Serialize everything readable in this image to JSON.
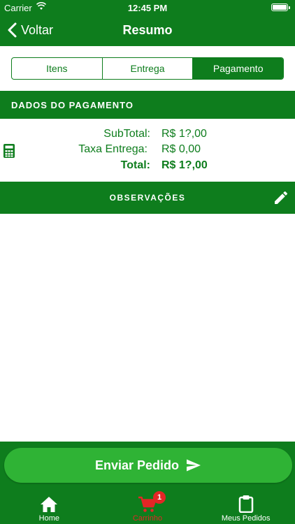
{
  "status_bar": {
    "carrier": "Carrier",
    "time": "12:45 PM"
  },
  "nav": {
    "back_label": "Voltar",
    "title": "Resumo"
  },
  "tabs_segment": [
    {
      "label": "Itens",
      "active": false
    },
    {
      "label": "Entrega",
      "active": false
    },
    {
      "label": "Pagamento",
      "active": true
    }
  ],
  "payment": {
    "section_title": "DADOS DO PAGAMENTO",
    "rows": [
      {
        "label": "SubTotal:",
        "value": "R$ 1?,00"
      },
      {
        "label": "Taxa Entrega:",
        "value": "R$ 0,00"
      },
      {
        "label": "Total:",
        "value": "R$ 1?,00"
      }
    ]
  },
  "observations": {
    "title": "OBSERVAÇÕES"
  },
  "send_button": {
    "label": "Enviar Pedido"
  },
  "tabbar": {
    "items": [
      {
        "label": "Home",
        "icon": "home-icon"
      },
      {
        "label": "Carrinho",
        "icon": "cart-icon",
        "badge": "1",
        "active": true
      },
      {
        "label": "Meus Pedidos",
        "icon": "clipboard-icon"
      }
    ]
  },
  "colors": {
    "primary": "#0e7d1d",
    "button": "#2fb335",
    "accent": "#e32626",
    "background": "#ffffff"
  }
}
